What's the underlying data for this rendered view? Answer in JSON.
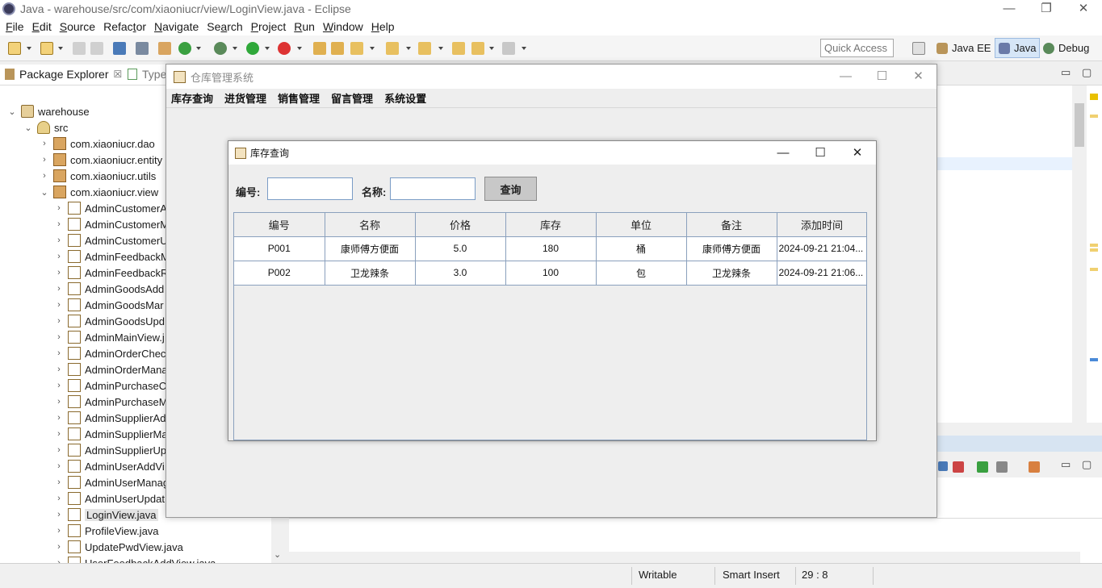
{
  "eclipse": {
    "window_title": "Java - warehouse/src/com/xiaoniucr/view/LoginView.java - Eclipse",
    "window_controls": [
      "—",
      "❐",
      "✕"
    ],
    "menu": [
      {
        "underline": "F",
        "rest": "ile"
      },
      {
        "underline": "E",
        "rest": "dit"
      },
      {
        "underline": "S",
        "rest": "ource"
      },
      {
        "pre": "Refac",
        "underline": "t",
        "rest": "or"
      },
      {
        "underline": "N",
        "rest": "avigate"
      },
      {
        "pre": "Se",
        "underline": "a",
        "rest": "rch"
      },
      {
        "underline": "P",
        "rest": "roject"
      },
      {
        "underline": "R",
        "rest": "un"
      },
      {
        "underline": "W",
        "rest": "indow"
      },
      {
        "underline": "H",
        "rest": "elp"
      }
    ],
    "quick_access_placeholder": "Quick Access",
    "perspectives": {
      "java_ee": "Java EE",
      "java": "Java",
      "debug": "Debug"
    },
    "package_explorer": {
      "tab_label": "Package Explorer",
      "tab_close": "☒",
      "second_tab_label": "Type",
      "tree": [
        {
          "label": "warehouse",
          "icon": "project-icon",
          "level": 0,
          "expanded": true
        },
        {
          "label": "src",
          "icon": "source-folder-icon",
          "level": 1,
          "expanded": true
        },
        {
          "label": "com.xiaoniucr.dao",
          "icon": "package-icon",
          "level": 2,
          "expanded": false
        },
        {
          "label": "com.xiaoniucr.entity",
          "icon": "package-icon",
          "level": 2,
          "expanded": false
        },
        {
          "label": "com.xiaoniucr.utils",
          "icon": "package-icon",
          "level": 2,
          "expanded": false
        },
        {
          "label": "com.xiaoniucr.view",
          "icon": "package-icon",
          "level": 2,
          "expanded": true
        },
        {
          "label": "AdminCustomerA",
          "icon": "java-file-icon",
          "level": 3
        },
        {
          "label": "AdminCustomerM",
          "icon": "java-file-icon",
          "level": 3
        },
        {
          "label": "AdminCustomerU",
          "icon": "java-file-icon",
          "level": 3
        },
        {
          "label": "AdminFeedbackM",
          "icon": "java-file-icon",
          "level": 3
        },
        {
          "label": "AdminFeedbackR",
          "icon": "java-file-icon",
          "level": 3
        },
        {
          "label": "AdminGoodsAdd",
          "icon": "java-file-icon",
          "level": 3
        },
        {
          "label": "AdminGoodsMar",
          "icon": "java-file-icon",
          "level": 3
        },
        {
          "label": "AdminGoodsUpd",
          "icon": "java-file-icon",
          "level": 3
        },
        {
          "label": "AdminMainView.j",
          "icon": "java-file-icon",
          "level": 3
        },
        {
          "label": "AdminOrderChec",
          "icon": "java-file-icon",
          "level": 3
        },
        {
          "label": "AdminOrderMana",
          "icon": "java-file-icon",
          "level": 3
        },
        {
          "label": "AdminPurchaseCl",
          "icon": "java-file-icon",
          "level": 3
        },
        {
          "label": "AdminPurchaseM",
          "icon": "java-file-icon",
          "level": 3
        },
        {
          "label": "AdminSupplierAd",
          "icon": "java-file-icon",
          "level": 3
        },
        {
          "label": "AdminSupplierMa",
          "icon": "java-file-icon",
          "level": 3
        },
        {
          "label": "AdminSupplierUp",
          "icon": "java-file-icon",
          "level": 3
        },
        {
          "label": "AdminUserAddVi",
          "icon": "java-file-icon",
          "level": 3
        },
        {
          "label": "AdminUserManag",
          "icon": "java-file-icon",
          "level": 3
        },
        {
          "label": "AdminUserUpdat",
          "icon": "java-file-icon",
          "level": 3
        },
        {
          "label": "LoginView.java",
          "icon": "java-file-icon",
          "level": 3,
          "selected": true
        },
        {
          "label": "ProfileView.java",
          "icon": "java-file-icon",
          "level": 3
        },
        {
          "label": "UpdatePwdView.java",
          "icon": "java-file-icon",
          "level": 3
        },
        {
          "label": "UserFeedbackAddView.java",
          "icon": "java-file-icon",
          "level": 3
        }
      ]
    },
    "status_bar": {
      "writable": "Writable",
      "insert_mode": "Smart Insert",
      "cursor_position": "29 : 8"
    }
  },
  "app": {
    "window_title": "仓库管理系统",
    "window_controls": [
      "—",
      "☐",
      "✕"
    ],
    "menu": [
      "库存查询",
      "进货管理",
      "销售管理",
      "留言管理",
      "系统设置"
    ],
    "inventory_frame": {
      "title": "库存查询",
      "window_controls": [
        "—",
        "☐",
        "✕"
      ],
      "code_label": "编号:",
      "code_value": "",
      "name_label": "名称:",
      "name_value": "",
      "query_button": "查询",
      "columns": [
        "编号",
        "名称",
        "价格",
        "库存",
        "单位",
        "备注",
        "添加时间"
      ],
      "rows": [
        [
          "P001",
          "康师傅方便面",
          "5.0",
          "180",
          "桶",
          "康师傅方便面",
          "2024-09-21 21:04..."
        ],
        [
          "P002",
          "卫龙辣条",
          "3.0",
          "100",
          "包",
          "卫龙辣条",
          "2024-09-21 21:06..."
        ]
      ]
    }
  }
}
